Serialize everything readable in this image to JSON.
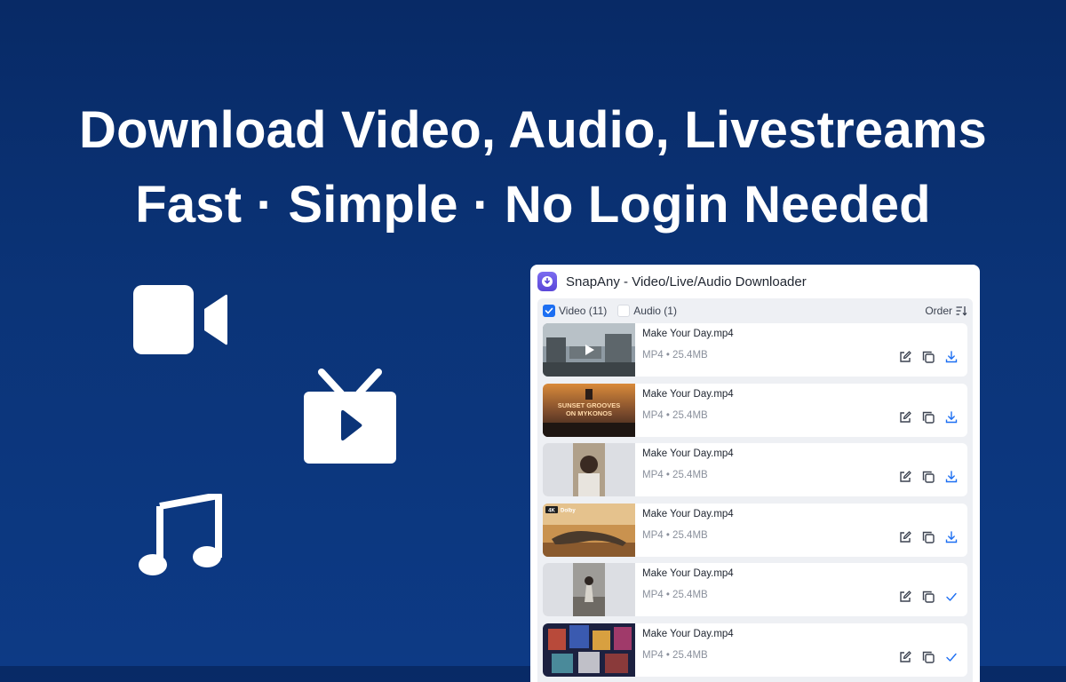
{
  "hero": {
    "line1": "Download Video, Audio, Livestreams",
    "line2": "Fast · Simple · No Login Needed"
  },
  "feature_icons": [
    "video-camera-icon",
    "tv-play-icon",
    "music-note-icon"
  ],
  "panel": {
    "title": "SnapAny - Video/Live/Audio Downloader",
    "filters": {
      "video": {
        "label": "Video (11)",
        "checked": true
      },
      "audio": {
        "label": "Audio (1)",
        "checked": false
      },
      "order_label": "Order"
    },
    "items": [
      {
        "name": "Make Your Day.mp4",
        "meta": "MP4 • 25.4MB",
        "status": "download"
      },
      {
        "name": "Make Your Day.mp4",
        "meta": "MP4 • 25.4MB",
        "status": "download"
      },
      {
        "name": "Make Your Day.mp4",
        "meta": "MP4 • 25.4MB",
        "status": "download"
      },
      {
        "name": "Make Your Day.mp4",
        "meta": "MP4 • 25.4MB",
        "status": "download"
      },
      {
        "name": "Make Your Day.mp4",
        "meta": "MP4 • 25.4MB",
        "status": "done"
      },
      {
        "name": "Make Your Day.mp4",
        "meta": "MP4 • 25.4MB",
        "status": "done"
      }
    ],
    "thumb_text": {
      "t2_line1": "SUNSET GROOVES",
      "t2_line2": "ON MYKONOS",
      "t4_badge": "4K",
      "t4_dolby": "Dolby"
    }
  },
  "colors": {
    "background": "#0b3478",
    "accent": "#1d6ff2",
    "logo": "#6a58e6"
  }
}
